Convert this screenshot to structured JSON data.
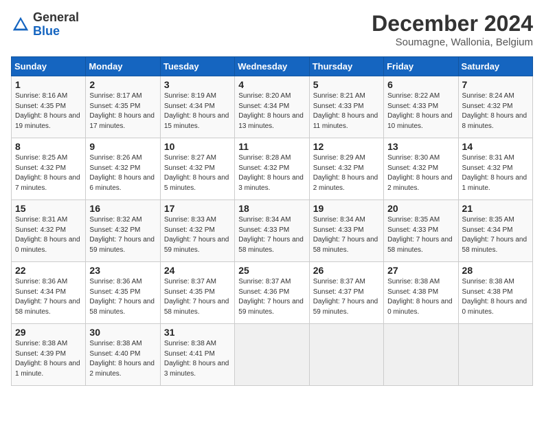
{
  "header": {
    "logo_line1": "General",
    "logo_line2": "Blue",
    "month": "December 2024",
    "location": "Soumagne, Wallonia, Belgium"
  },
  "days_of_week": [
    "Sunday",
    "Monday",
    "Tuesday",
    "Wednesday",
    "Thursday",
    "Friday",
    "Saturday"
  ],
  "weeks": [
    [
      {
        "day": "1",
        "detail": "Sunrise: 8:16 AM\nSunset: 4:35 PM\nDaylight: 8 hours and 19 minutes."
      },
      {
        "day": "2",
        "detail": "Sunrise: 8:17 AM\nSunset: 4:35 PM\nDaylight: 8 hours and 17 minutes."
      },
      {
        "day": "3",
        "detail": "Sunrise: 8:19 AM\nSunset: 4:34 PM\nDaylight: 8 hours and 15 minutes."
      },
      {
        "day": "4",
        "detail": "Sunrise: 8:20 AM\nSunset: 4:34 PM\nDaylight: 8 hours and 13 minutes."
      },
      {
        "day": "5",
        "detail": "Sunrise: 8:21 AM\nSunset: 4:33 PM\nDaylight: 8 hours and 11 minutes."
      },
      {
        "day": "6",
        "detail": "Sunrise: 8:22 AM\nSunset: 4:33 PM\nDaylight: 8 hours and 10 minutes."
      },
      {
        "day": "7",
        "detail": "Sunrise: 8:24 AM\nSunset: 4:32 PM\nDaylight: 8 hours and 8 minutes."
      }
    ],
    [
      {
        "day": "8",
        "detail": "Sunrise: 8:25 AM\nSunset: 4:32 PM\nDaylight: 8 hours and 7 minutes."
      },
      {
        "day": "9",
        "detail": "Sunrise: 8:26 AM\nSunset: 4:32 PM\nDaylight: 8 hours and 6 minutes."
      },
      {
        "day": "10",
        "detail": "Sunrise: 8:27 AM\nSunset: 4:32 PM\nDaylight: 8 hours and 5 minutes."
      },
      {
        "day": "11",
        "detail": "Sunrise: 8:28 AM\nSunset: 4:32 PM\nDaylight: 8 hours and 3 minutes."
      },
      {
        "day": "12",
        "detail": "Sunrise: 8:29 AM\nSunset: 4:32 PM\nDaylight: 8 hours and 2 minutes."
      },
      {
        "day": "13",
        "detail": "Sunrise: 8:30 AM\nSunset: 4:32 PM\nDaylight: 8 hours and 2 minutes."
      },
      {
        "day": "14",
        "detail": "Sunrise: 8:31 AM\nSunset: 4:32 PM\nDaylight: 8 hours and 1 minute."
      }
    ],
    [
      {
        "day": "15",
        "detail": "Sunrise: 8:31 AM\nSunset: 4:32 PM\nDaylight: 8 hours and 0 minutes."
      },
      {
        "day": "16",
        "detail": "Sunrise: 8:32 AM\nSunset: 4:32 PM\nDaylight: 7 hours and 59 minutes."
      },
      {
        "day": "17",
        "detail": "Sunrise: 8:33 AM\nSunset: 4:32 PM\nDaylight: 7 hours and 59 minutes."
      },
      {
        "day": "18",
        "detail": "Sunrise: 8:34 AM\nSunset: 4:33 PM\nDaylight: 7 hours and 58 minutes."
      },
      {
        "day": "19",
        "detail": "Sunrise: 8:34 AM\nSunset: 4:33 PM\nDaylight: 7 hours and 58 minutes."
      },
      {
        "day": "20",
        "detail": "Sunrise: 8:35 AM\nSunset: 4:33 PM\nDaylight: 7 hours and 58 minutes."
      },
      {
        "day": "21",
        "detail": "Sunrise: 8:35 AM\nSunset: 4:34 PM\nDaylight: 7 hours and 58 minutes."
      }
    ],
    [
      {
        "day": "22",
        "detail": "Sunrise: 8:36 AM\nSunset: 4:34 PM\nDaylight: 7 hours and 58 minutes."
      },
      {
        "day": "23",
        "detail": "Sunrise: 8:36 AM\nSunset: 4:35 PM\nDaylight: 7 hours and 58 minutes."
      },
      {
        "day": "24",
        "detail": "Sunrise: 8:37 AM\nSunset: 4:35 PM\nDaylight: 7 hours and 58 minutes."
      },
      {
        "day": "25",
        "detail": "Sunrise: 8:37 AM\nSunset: 4:36 PM\nDaylight: 7 hours and 59 minutes."
      },
      {
        "day": "26",
        "detail": "Sunrise: 8:37 AM\nSunset: 4:37 PM\nDaylight: 7 hours and 59 minutes."
      },
      {
        "day": "27",
        "detail": "Sunrise: 8:38 AM\nSunset: 4:38 PM\nDaylight: 8 hours and 0 minutes."
      },
      {
        "day": "28",
        "detail": "Sunrise: 8:38 AM\nSunset: 4:38 PM\nDaylight: 8 hours and 0 minutes."
      }
    ],
    [
      {
        "day": "29",
        "detail": "Sunrise: 8:38 AM\nSunset: 4:39 PM\nDaylight: 8 hours and 1 minute."
      },
      {
        "day": "30",
        "detail": "Sunrise: 8:38 AM\nSunset: 4:40 PM\nDaylight: 8 hours and 2 minutes."
      },
      {
        "day": "31",
        "detail": "Sunrise: 8:38 AM\nSunset: 4:41 PM\nDaylight: 8 hours and 3 minutes."
      },
      null,
      null,
      null,
      null
    ]
  ]
}
